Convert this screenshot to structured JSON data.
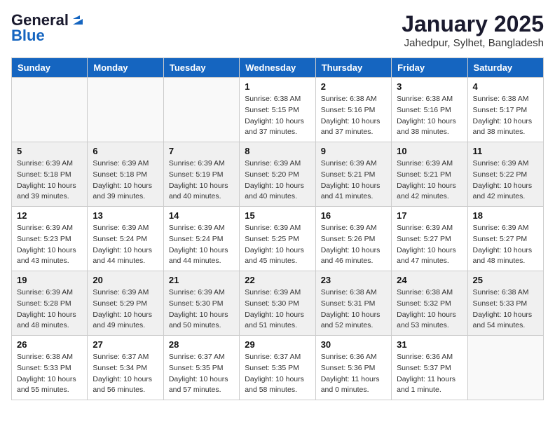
{
  "logo": {
    "line1": "General",
    "line2": "Blue"
  },
  "title": "January 2025",
  "subtitle": "Jahedpur, Sylhet, Bangladesh",
  "weekdays": [
    "Sunday",
    "Monday",
    "Tuesday",
    "Wednesday",
    "Thursday",
    "Friday",
    "Saturday"
  ],
  "weeks": [
    [
      {
        "day": "",
        "info": ""
      },
      {
        "day": "",
        "info": ""
      },
      {
        "day": "",
        "info": ""
      },
      {
        "day": "1",
        "info": "Sunrise: 6:38 AM\nSunset: 5:15 PM\nDaylight: 10 hours\nand 37 minutes."
      },
      {
        "day": "2",
        "info": "Sunrise: 6:38 AM\nSunset: 5:16 PM\nDaylight: 10 hours\nand 37 minutes."
      },
      {
        "day": "3",
        "info": "Sunrise: 6:38 AM\nSunset: 5:16 PM\nDaylight: 10 hours\nand 38 minutes."
      },
      {
        "day": "4",
        "info": "Sunrise: 6:38 AM\nSunset: 5:17 PM\nDaylight: 10 hours\nand 38 minutes."
      }
    ],
    [
      {
        "day": "5",
        "info": "Sunrise: 6:39 AM\nSunset: 5:18 PM\nDaylight: 10 hours\nand 39 minutes."
      },
      {
        "day": "6",
        "info": "Sunrise: 6:39 AM\nSunset: 5:18 PM\nDaylight: 10 hours\nand 39 minutes."
      },
      {
        "day": "7",
        "info": "Sunrise: 6:39 AM\nSunset: 5:19 PM\nDaylight: 10 hours\nand 40 minutes."
      },
      {
        "day": "8",
        "info": "Sunrise: 6:39 AM\nSunset: 5:20 PM\nDaylight: 10 hours\nand 40 minutes."
      },
      {
        "day": "9",
        "info": "Sunrise: 6:39 AM\nSunset: 5:21 PM\nDaylight: 10 hours\nand 41 minutes."
      },
      {
        "day": "10",
        "info": "Sunrise: 6:39 AM\nSunset: 5:21 PM\nDaylight: 10 hours\nand 42 minutes."
      },
      {
        "day": "11",
        "info": "Sunrise: 6:39 AM\nSunset: 5:22 PM\nDaylight: 10 hours\nand 42 minutes."
      }
    ],
    [
      {
        "day": "12",
        "info": "Sunrise: 6:39 AM\nSunset: 5:23 PM\nDaylight: 10 hours\nand 43 minutes."
      },
      {
        "day": "13",
        "info": "Sunrise: 6:39 AM\nSunset: 5:24 PM\nDaylight: 10 hours\nand 44 minutes."
      },
      {
        "day": "14",
        "info": "Sunrise: 6:39 AM\nSunset: 5:24 PM\nDaylight: 10 hours\nand 44 minutes."
      },
      {
        "day": "15",
        "info": "Sunrise: 6:39 AM\nSunset: 5:25 PM\nDaylight: 10 hours\nand 45 minutes."
      },
      {
        "day": "16",
        "info": "Sunrise: 6:39 AM\nSunset: 5:26 PM\nDaylight: 10 hours\nand 46 minutes."
      },
      {
        "day": "17",
        "info": "Sunrise: 6:39 AM\nSunset: 5:27 PM\nDaylight: 10 hours\nand 47 minutes."
      },
      {
        "day": "18",
        "info": "Sunrise: 6:39 AM\nSunset: 5:27 PM\nDaylight: 10 hours\nand 48 minutes."
      }
    ],
    [
      {
        "day": "19",
        "info": "Sunrise: 6:39 AM\nSunset: 5:28 PM\nDaylight: 10 hours\nand 48 minutes."
      },
      {
        "day": "20",
        "info": "Sunrise: 6:39 AM\nSunset: 5:29 PM\nDaylight: 10 hours\nand 49 minutes."
      },
      {
        "day": "21",
        "info": "Sunrise: 6:39 AM\nSunset: 5:30 PM\nDaylight: 10 hours\nand 50 minutes."
      },
      {
        "day": "22",
        "info": "Sunrise: 6:39 AM\nSunset: 5:30 PM\nDaylight: 10 hours\nand 51 minutes."
      },
      {
        "day": "23",
        "info": "Sunrise: 6:38 AM\nSunset: 5:31 PM\nDaylight: 10 hours\nand 52 minutes."
      },
      {
        "day": "24",
        "info": "Sunrise: 6:38 AM\nSunset: 5:32 PM\nDaylight: 10 hours\nand 53 minutes."
      },
      {
        "day": "25",
        "info": "Sunrise: 6:38 AM\nSunset: 5:33 PM\nDaylight: 10 hours\nand 54 minutes."
      }
    ],
    [
      {
        "day": "26",
        "info": "Sunrise: 6:38 AM\nSunset: 5:33 PM\nDaylight: 10 hours\nand 55 minutes."
      },
      {
        "day": "27",
        "info": "Sunrise: 6:37 AM\nSunset: 5:34 PM\nDaylight: 10 hours\nand 56 minutes."
      },
      {
        "day": "28",
        "info": "Sunrise: 6:37 AM\nSunset: 5:35 PM\nDaylight: 10 hours\nand 57 minutes."
      },
      {
        "day": "29",
        "info": "Sunrise: 6:37 AM\nSunset: 5:35 PM\nDaylight: 10 hours\nand 58 minutes."
      },
      {
        "day": "30",
        "info": "Sunrise: 6:36 AM\nSunset: 5:36 PM\nDaylight: 11 hours\nand 0 minutes."
      },
      {
        "day": "31",
        "info": "Sunrise: 6:36 AM\nSunset: 5:37 PM\nDaylight: 11 hours\nand 1 minute."
      },
      {
        "day": "",
        "info": ""
      }
    ]
  ]
}
